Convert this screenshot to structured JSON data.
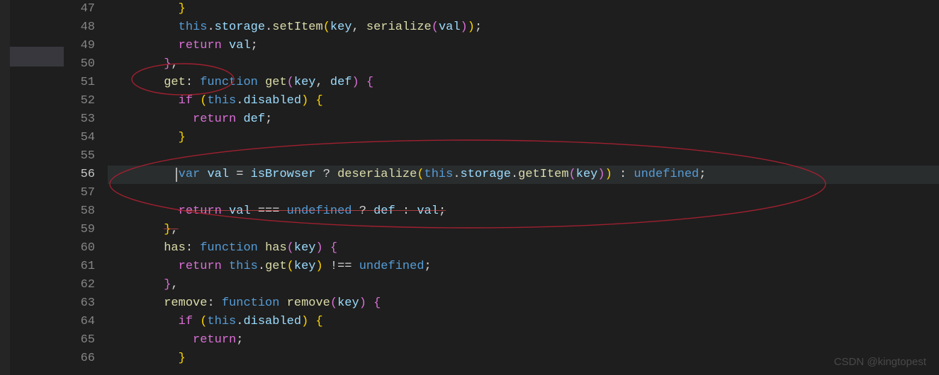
{
  "code": {
    "line47": {
      "t1": "}"
    },
    "line48": {
      "t1": "this",
      "t2": ".",
      "t3": "storage",
      "t4": ".",
      "t5": "setItem",
      "t6": "(",
      "t7": "key",
      "t8": ", ",
      "t9": "serialize",
      "t10": "(",
      "t11": "val",
      "t12": ")",
      "t13": ")",
      "t14": ";"
    },
    "line49": {
      "t1": "return",
      "t2": " ",
      "t3": "val",
      "t4": ";"
    },
    "line50": {
      "t1": "}",
      "t2": ","
    },
    "line51": {
      "t1": "get",
      "t2": ":",
      "t3": " ",
      "t4": "function",
      "t5": " ",
      "t6": "get",
      "t7": "(",
      "t8": "key",
      "t9": ", ",
      "t10": "def",
      "t11": ")",
      "t12": " ",
      "t13": "{"
    },
    "line52": {
      "t1": "if",
      "t2": " ",
      "t3": "(",
      "t4": "this",
      "t5": ".",
      "t6": "disabled",
      "t7": ")",
      "t8": " ",
      "t9": "{"
    },
    "line53": {
      "t1": "return",
      "t2": " ",
      "t3": "def",
      "t4": ";"
    },
    "line54": {
      "t1": "}"
    },
    "line55": {},
    "line56": {
      "t1": "var",
      "t2": " ",
      "t3": "val",
      "t4": " ",
      "t5": "=",
      "t6": " ",
      "t7": "isBrowser",
      "t8": " ",
      "t9": "?",
      "t10": " ",
      "t11": "deserialize",
      "t12": "(",
      "t13": "this",
      "t14": ".",
      "t15": "storage",
      "t16": ".",
      "t17": "getItem",
      "t18": "(",
      "t19": "key",
      "t20": ")",
      "t21": ")",
      "t22": " ",
      "t23": ":",
      "t24": " ",
      "t25": "undefined",
      "t26": ";"
    },
    "line57": {},
    "line58": {
      "t1": "return",
      "t2": " ",
      "t3": "val",
      "t4": " ",
      "t5": "===",
      "t6": " ",
      "t7": "undefined",
      "t8": " ",
      "t9": "?",
      "t10": " ",
      "t11": "def",
      "t12": " ",
      "t13": ":",
      "t14": " ",
      "t15": "val",
      "t16": ";"
    },
    "line59": {
      "t1": "}",
      "t2": ","
    },
    "line60": {
      "t1": "has",
      "t2": ":",
      "t3": " ",
      "t4": "function",
      "t5": " ",
      "t6": "has",
      "t7": "(",
      "t8": "key",
      "t9": ")",
      "t10": " ",
      "t11": "{"
    },
    "line61": {
      "t1": "return",
      "t2": " ",
      "t3": "this",
      "t4": ".",
      "t5": "get",
      "t6": "(",
      "t7": "key",
      "t8": ")",
      "t9": " ",
      "t10": "!==",
      "t11": " ",
      "t12": "undefined",
      "t13": ";"
    },
    "line62": {
      "t1": "}",
      "t2": ","
    },
    "line63": {
      "t1": "remove",
      "t2": ":",
      "t3": " ",
      "t4": "function",
      "t5": " ",
      "t6": "remove",
      "t7": "(",
      "t8": "key",
      "t9": ")",
      "t10": " ",
      "t11": "{"
    },
    "line64": {
      "t1": "if",
      "t2": " ",
      "t3": "(",
      "t4": "this",
      "t5": ".",
      "t6": "disabled",
      "t7": ")",
      "t8": " ",
      "t9": "{"
    },
    "line65": {
      "t1": "return",
      "t2": ";"
    },
    "line66": {
      "t1": "}"
    }
  },
  "lineNumbers": {
    "n47": "47",
    "n48": "48",
    "n49": "49",
    "n50": "50",
    "n51": "51",
    "n52": "52",
    "n53": "53",
    "n54": "54",
    "n55": "55",
    "n56": "56",
    "n57": "57",
    "n58": "58",
    "n59": "59",
    "n60": "60",
    "n61": "61",
    "n62": "62",
    "n63": "63",
    "n64": "64",
    "n65": "65",
    "n66": "66"
  },
  "currentLine": 56,
  "watermark": "CSDN @kingtopest"
}
